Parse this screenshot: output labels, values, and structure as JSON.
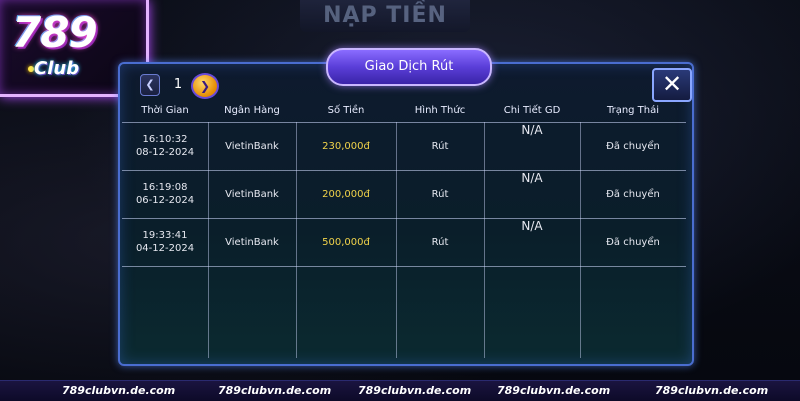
{
  "logo": {
    "number": "789",
    "suffix": "Club"
  },
  "background": {
    "banner": "NẠP TIỀN"
  },
  "dialog": {
    "title": "Giao Dịch Rút",
    "page_number": "1",
    "close_label": "✕",
    "prev_label": "❮",
    "next_label": "❯"
  },
  "table": {
    "headers": [
      "Thời Gian",
      "Ngân Hàng",
      "Số Tiền",
      "Hình Thức",
      "Chi Tiết GD",
      "Trạng Thái"
    ],
    "rows": [
      {
        "time": "16:10:32",
        "date": "08-12-2024",
        "bank": "VietinBank",
        "amount": "230,000đ",
        "method": "Rút",
        "detail": "N/A",
        "status": "Đã chuyển"
      },
      {
        "time": "16:19:08",
        "date": "06-12-2024",
        "bank": "VietinBank",
        "amount": "200,000đ",
        "method": "Rút",
        "detail": "N/A",
        "status": "Đã chuyển"
      },
      {
        "time": "19:33:41",
        "date": "04-12-2024",
        "bank": "VietinBank",
        "amount": "500,000đ",
        "method": "Rút",
        "detail": "N/A",
        "status": "Đã chuyển"
      }
    ]
  },
  "footer": {
    "items": [
      "789clubvn.de.com",
      "789clubvn.de.com",
      "789clubvn.de.com",
      "789clubvn.de.com",
      "789clubvn.de.com"
    ]
  },
  "colors": {
    "accent": "#5a3ed8",
    "amount": "#f1d34a",
    "border": "#4a6dd0"
  }
}
